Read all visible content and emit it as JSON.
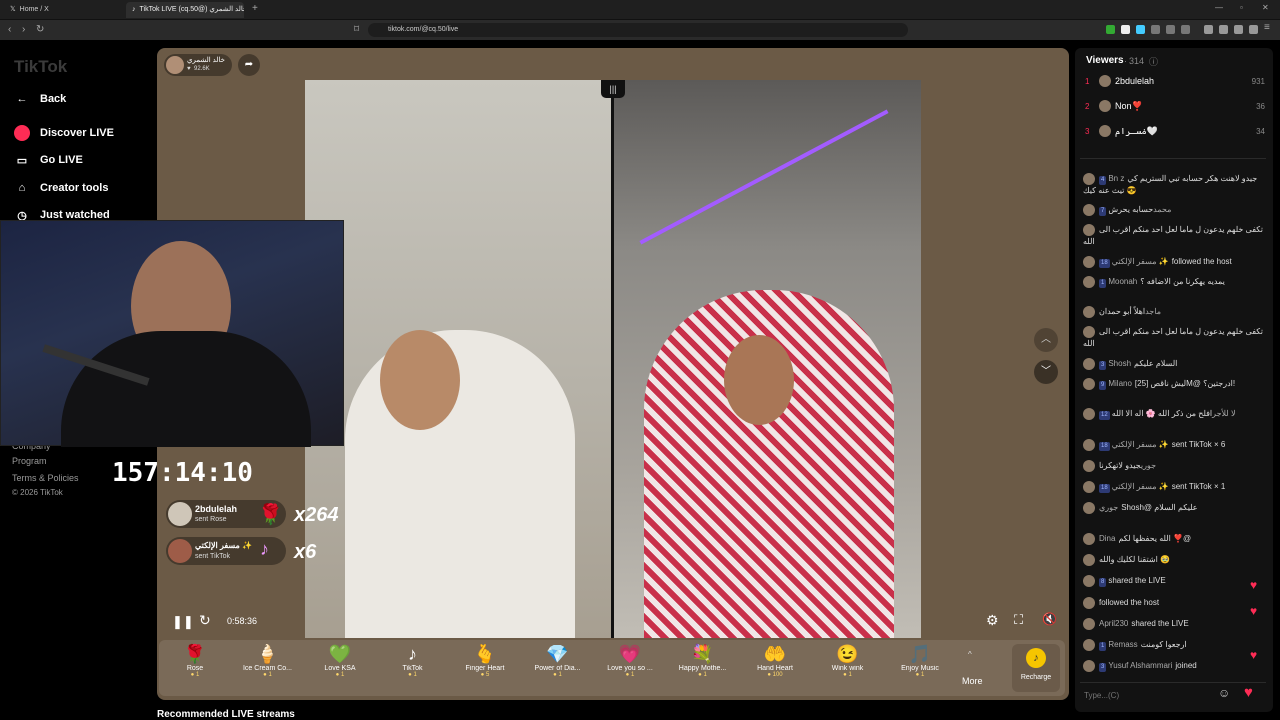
{
  "browser": {
    "tabs": [
      {
        "label": "Home / X"
      },
      {
        "label": "TikTok LIVE (cq.50@) خالد الشمري"
      }
    ],
    "url": "tiktok.com/@cq.50/live"
  },
  "sidebar": {
    "logo": "TikTok",
    "back_label": "Back",
    "items": [
      {
        "label": "Discover LIVE"
      },
      {
        "label": "Go LIVE"
      },
      {
        "label": "Creator tools"
      },
      {
        "label": "Just watched"
      }
    ],
    "footer": {
      "company": "Company",
      "program": "Program",
      "terms": "Terms & Policies",
      "copyright": "© 2026 TikTok"
    }
  },
  "host": {
    "name": "خالد الشمري",
    "likes": "92.6K"
  },
  "overlay_timer": "157:14:10",
  "gift_notices": [
    {
      "user": "2bdulelah",
      "action": "sent Rose",
      "count": "x264"
    },
    {
      "user": "مسفر الإلكتي ✨",
      "action": "sent TikTok",
      "count": "x6"
    }
  ],
  "player": {
    "elapsed": "0:58:36"
  },
  "gifts": [
    {
      "name": "Rose",
      "cost": "1",
      "icon": "🌹"
    },
    {
      "name": "Ice Cream Co...",
      "cost": "1",
      "icon": "🍦"
    },
    {
      "name": "Love KSA",
      "cost": "1",
      "icon": "💚"
    },
    {
      "name": "TikTok",
      "cost": "1",
      "icon": "♪"
    },
    {
      "name": "Finger Heart",
      "cost": "5",
      "icon": "🫰"
    },
    {
      "name": "Power of Dia...",
      "cost": "1",
      "icon": "💎"
    },
    {
      "name": "Love you so ...",
      "cost": "1",
      "icon": "💗"
    },
    {
      "name": "Happy Mothe...",
      "cost": "1",
      "icon": "💐"
    },
    {
      "name": "Hand Heart",
      "cost": "100",
      "icon": "🤲"
    },
    {
      "name": "Wink wink",
      "cost": "1",
      "icon": "😉"
    },
    {
      "name": "Enjoy Music",
      "cost": "1",
      "icon": "🎵"
    }
  ],
  "more_label": "More",
  "recharge_label": "Recharge",
  "recommended": "Recommended LIVE streams",
  "viewers": {
    "title": "Viewers",
    "count": "314",
    "top": [
      {
        "rank": "1",
        "name": "2bdulelah",
        "score": "931"
      },
      {
        "rank": "2",
        "name": "Non❣️",
        "score": "36"
      },
      {
        "rank": "3",
        "name": "ݥسـرام🤍",
        "score": "34"
      }
    ]
  },
  "chat": [
    {
      "badge": "4",
      "name": "Bn z",
      "text": "جيدو لاهنت هكر حسابه تبي الستريم كي تيث عنه كيك 😎"
    },
    {
      "badge": "7",
      "name": "محمد",
      "text": "حسابه يحرش"
    },
    {
      "badge": "",
      "name": "",
      "text": "تكفى خلهم يدعون ل ماما لعل احد منكم اقرب الى الله"
    },
    {
      "badge": "18",
      "name": "مسفر الإلكتي ✨",
      "text": "followed the host"
    },
    {
      "badge": "1",
      "name": "Moonah",
      "text": "يمديه يهكرنا من الاضافه ؟"
    },
    {
      "badge": "",
      "name": "ماجد",
      "text": "اهلاً أبو حمدان"
    },
    {
      "badge": "",
      "name": "",
      "text": "تكفى خلهم يدعون ل ماما لعل احد منكم اقرب الى الله"
    },
    {
      "badge": "3",
      "name": "Shosh",
      "text": "السلام عليكم"
    },
    {
      "badge": "9",
      "name": "Milano",
      "text": "ليش ناقص [25]M@ ادرجتين؟!"
    },
    {
      "badge": "12",
      "name": "لا للأجر",
      "text": "افلح من ذكر الله 🌸 اله الا الله"
    },
    {
      "badge": "18",
      "name": "مسفر الإلكتي ✨",
      "text": "sent TikTok × 6"
    },
    {
      "badge": "",
      "name": "جوري",
      "text": "جيدو لاتهكرنا"
    },
    {
      "badge": "18",
      "name": "مسفر الإلكتي ✨",
      "text": "sent TikTok × 1"
    },
    {
      "badge": "",
      "name": "جوري",
      "text": "Shosh@ عليكم السلام"
    },
    {
      "badge": "",
      "name": "Dina",
      "text": "الله يحفظها لكم ❣️@"
    },
    {
      "badge": "",
      "name": "",
      "text": "اشتقنا لكليك والله 🥹"
    },
    {
      "badge": "8",
      "name": "",
      "text": "shared the LIVE"
    },
    {
      "badge": "",
      "name": "",
      "text": "followed the host"
    },
    {
      "badge": "",
      "name": "April230",
      "text": "shared the LIVE"
    },
    {
      "badge": "1",
      "name": "Remass",
      "text": "ارجعوا كومنت"
    },
    {
      "badge": "3",
      "name": "Yusuf Alshammari",
      "text": "joined"
    }
  ],
  "chat_input_placeholder": "Type...(C)",
  "colors": {
    "accent": "#fe2c55",
    "stage": "#6b5a46",
    "panel": "#121212"
  }
}
